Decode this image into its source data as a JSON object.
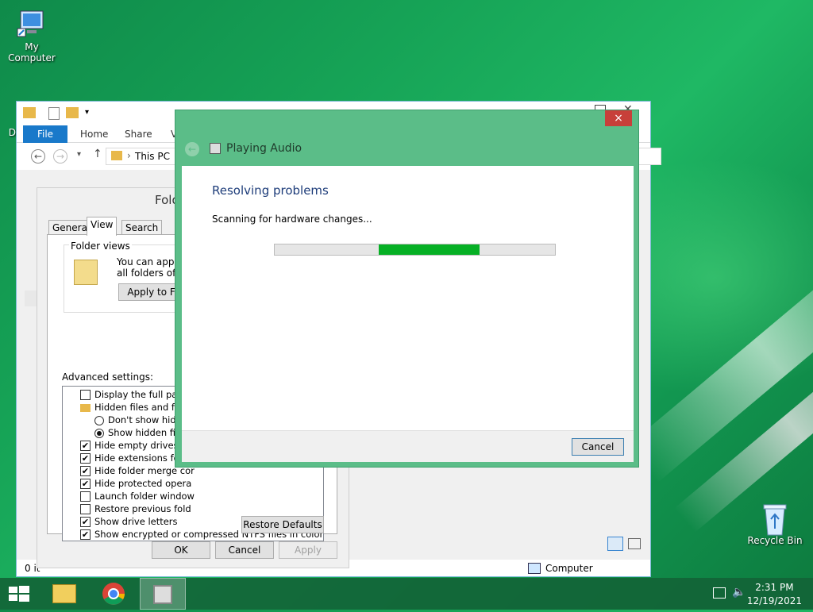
{
  "desktop": {
    "icons": [
      {
        "label": "My Computer"
      },
      {
        "label": "Dat"
      },
      {
        "label": "Recycle Bin"
      }
    ]
  },
  "explorer": {
    "ribbon": {
      "file": "File",
      "home": "Home",
      "share": "Share",
      "view": "V"
    },
    "address": "This PC",
    "status_left": "0 it",
    "status_computer": "Computer"
  },
  "folder_options": {
    "title": "Fold",
    "tabs": [
      "General",
      "View",
      "Search"
    ],
    "folder_views_label": "Folder views",
    "folder_views_text1": "You can apply t",
    "folder_views_text2": "all folders of this",
    "apply_to_folders": "Apply to Fo",
    "advanced_label": "Advanced settings:",
    "advanced_items": [
      {
        "type": "checkbox",
        "checked": false,
        "label": "Display the full path in"
      },
      {
        "type": "folder",
        "label": "Hidden files and folde"
      },
      {
        "type": "radio",
        "checked": false,
        "label": "Don't show hidde"
      },
      {
        "type": "radio",
        "checked": true,
        "label": "Show hidden files"
      },
      {
        "type": "checkbox",
        "checked": true,
        "label": "Hide empty drives"
      },
      {
        "type": "checkbox",
        "checked": true,
        "label": "Hide extensions for kn"
      },
      {
        "type": "checkbox",
        "checked": true,
        "label": "Hide folder merge cor"
      },
      {
        "type": "checkbox",
        "checked": true,
        "label": "Hide protected opera"
      },
      {
        "type": "checkbox",
        "checked": false,
        "label": "Launch folder window"
      },
      {
        "type": "checkbox",
        "checked": false,
        "label": "Restore previous fold"
      },
      {
        "type": "checkbox",
        "checked": true,
        "label": "Show drive letters"
      },
      {
        "type": "checkbox",
        "checked": true,
        "label": "Show encrypted or compressed NTFS files in color"
      }
    ],
    "restore_defaults": "Restore Defaults",
    "ok": "OK",
    "cancel": "Cancel",
    "apply": "Apply"
  },
  "troubleshooter": {
    "title": "Playing Audio",
    "close": "×",
    "heading": "Resolving problems",
    "status": "Scanning for hardware changes...",
    "progress_start": 0.37,
    "progress_end": 0.73,
    "cancel": "Cancel"
  },
  "taskbar": {
    "time": "2:31 PM",
    "date": "12/19/2021"
  },
  "colors": {
    "accent": "#1979ca",
    "progress": "#06b025",
    "dialog_frame": "#5bbd88"
  }
}
